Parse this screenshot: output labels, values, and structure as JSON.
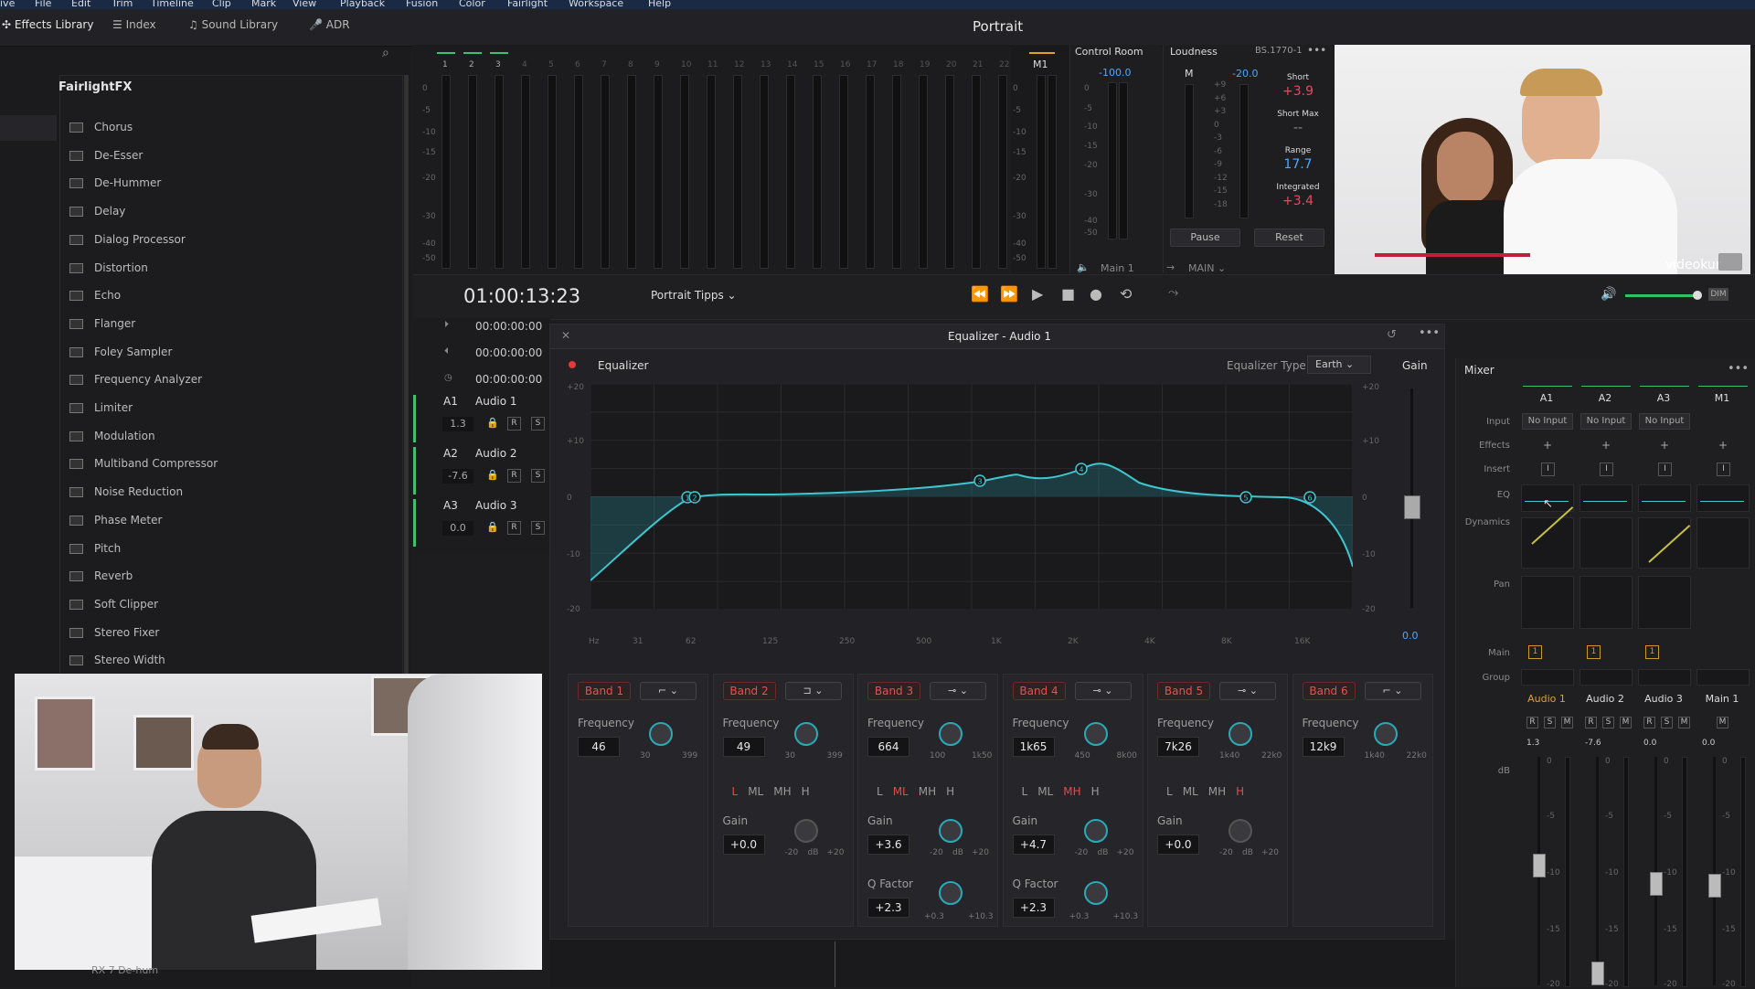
{
  "menu": [
    "ive",
    "File",
    "Edit",
    "Trim",
    "Timeline",
    "Clip",
    "Mark",
    "View",
    "Playback",
    "Fusion",
    "Color",
    "Fairlight",
    "Workspace",
    "Help"
  ],
  "toolbar": {
    "effects_library": "Effects Library",
    "index": "Index",
    "sound_library": "Sound Library",
    "adr": "ADR",
    "page_title": "Portrait"
  },
  "fx": {
    "title": "FairlightFX",
    "items": [
      "Chorus",
      "De-Esser",
      "De-Hummer",
      "Delay",
      "Dialog Processor",
      "Distortion",
      "Echo",
      "Flanger",
      "Foley Sampler",
      "Frequency Analyzer",
      "Limiter",
      "Modulation",
      "Multiband Compressor",
      "Noise Reduction",
      "Phase Meter",
      "Pitch",
      "Reverb",
      "Soft Clipper",
      "Stereo Fixer",
      "Stereo Width"
    ],
    "bottom_item": "RX 7 De-hum"
  },
  "meters": {
    "channels": [
      "1",
      "2",
      "3",
      "4",
      "5",
      "6",
      "7",
      "8",
      "9",
      "10",
      "11",
      "12",
      "13",
      "14",
      "15",
      "16",
      "17",
      "18",
      "19",
      "20",
      "21",
      "22"
    ],
    "scale": [
      "0",
      "-5",
      "-10",
      "-15",
      "-20",
      "-30",
      "-40",
      "-50"
    ],
    "m1_label": "M1"
  },
  "control_room": {
    "title": "Control Room",
    "value": "-100.0",
    "scale": [
      "0",
      "-5",
      "-10",
      "-15",
      "-20",
      "-30",
      "-40",
      "-50"
    ],
    "footer": "Main 1",
    "main_select": "MAIN"
  },
  "loudness": {
    "title": "Loudness",
    "standard": "BS.1770-1",
    "m_label": "M",
    "m_value": "-20.0",
    "scale": [
      "+9",
      "+6",
      "+3",
      "0",
      "-3",
      "-6",
      "-9",
      "-12",
      "-15",
      "-18"
    ],
    "short_label": "Short",
    "short_value": "+3.9",
    "short_max_label": "Short Max",
    "short_max_value": "--",
    "range_label": "Range",
    "range_value": "17.7",
    "integrated_label": "Integrated",
    "integrated_value": "+3.4",
    "pause": "Pause",
    "reset": "Reset"
  },
  "video": {
    "watermark": "videokur"
  },
  "transport": {
    "timecode": "01:00:13:23",
    "timeline_name": "Portrait Tipps",
    "tc_rows": [
      "00:00:00:00",
      "00:00:00:00",
      "00:00:00:00"
    ]
  },
  "tracks": [
    {
      "id": "A1",
      "name": "Audio 1",
      "level": "1.3",
      "r": "R",
      "s": "S"
    },
    {
      "id": "A2",
      "name": "Audio 2",
      "level": "-7.6",
      "r": "R",
      "s": "S"
    },
    {
      "id": "A3",
      "name": "Audio 3",
      "level": "0.0",
      "r": "R",
      "s": "S"
    }
  ],
  "eq": {
    "window_title": "Equalizer - Audio 1",
    "toggle_label": "Equalizer",
    "type_label": "Equalizer Type",
    "type_value": "Earth",
    "gain_label": "Gain",
    "gain_value": "0.0",
    "db_left": [
      "+20",
      "+10",
      "0",
      "-10",
      "-20"
    ],
    "db_right": [
      "+20",
      "+10",
      "0",
      "-10",
      "-20"
    ],
    "freq_axis": [
      "Hz",
      "31",
      "62",
      "125",
      "250",
      "500",
      "1K",
      "2K",
      "4K",
      "8K",
      "16K"
    ],
    "nodes": [
      "1",
      "2",
      "3",
      "4",
      "5",
      "6"
    ],
    "bands": [
      {
        "name": "Band 1",
        "freq_label": "Frequency",
        "freq": "46",
        "range_lo": "30",
        "range_hi": "399"
      },
      {
        "name": "Band 2",
        "freq_label": "Frequency",
        "freq": "49",
        "range_lo": "30",
        "range_hi": "399",
        "lh": [
          "L",
          "ML",
          "MH",
          "H"
        ],
        "active": "L",
        "gain_label": "Gain",
        "gain": "+0.0",
        "g_lo": "-20",
        "g_mid": "dB",
        "g_hi": "+20"
      },
      {
        "name": "Band 3",
        "freq_label": "Frequency",
        "freq": "664",
        "range_lo": "100",
        "range_hi": "1k50",
        "lh": [
          "L",
          "ML",
          "MH",
          "H"
        ],
        "active": "ML",
        "gain_label": "Gain",
        "gain": "+3.6",
        "g_lo": "-20",
        "g_mid": "dB",
        "g_hi": "+20",
        "q_label": "Q Factor",
        "q": "+2.3",
        "q_lo": "+0.3",
        "q_hi": "+10.3"
      },
      {
        "name": "Band 4",
        "freq_label": "Frequency",
        "freq": "1k65",
        "range_lo": "450",
        "range_hi": "8k00",
        "lh": [
          "L",
          "ML",
          "MH",
          "H"
        ],
        "active": "MH",
        "gain_label": "Gain",
        "gain": "+4.7",
        "g_lo": "-20",
        "g_mid": "dB",
        "g_hi": "+20",
        "q_label": "Q Factor",
        "q": "+2.3",
        "q_lo": "+0.3",
        "q_hi": "+10.3"
      },
      {
        "name": "Band 5",
        "freq_label": "Frequency",
        "freq": "7k26",
        "range_lo": "1k40",
        "range_hi": "22k0",
        "lh": [
          "L",
          "ML",
          "MH",
          "H"
        ],
        "active": "H",
        "gain_label": "Gain",
        "gain": "+0.0",
        "g_lo": "-20",
        "g_mid": "dB",
        "g_hi": "+20"
      },
      {
        "name": "Band 6",
        "freq_label": "Frequency",
        "freq": "12k9",
        "range_lo": "1k40",
        "range_hi": "22k0"
      }
    ]
  },
  "mixer": {
    "title": "Mixer",
    "channels": [
      "A1",
      "A2",
      "A3",
      "M1"
    ],
    "row_labels": [
      "Input",
      "Effects",
      "Insert",
      "EQ",
      "Dynamics",
      "Pan",
      "Main",
      "Group"
    ],
    "inputs": [
      "No Input",
      "No Input",
      "No Input"
    ],
    "plus": "+",
    "insert_icon": "I",
    "main_num": "1",
    "names": [
      "Audio 1",
      "Audio 2",
      "Audio 3",
      "Main 1"
    ],
    "rsm": [
      "R",
      "S",
      "M"
    ],
    "m_only": "M",
    "levels": [
      "1.3",
      "-7.6",
      "0.0",
      "0.0"
    ],
    "db_label": "dB",
    "scale": [
      "0",
      "-5",
      "-10",
      "-15",
      "-20"
    ]
  }
}
